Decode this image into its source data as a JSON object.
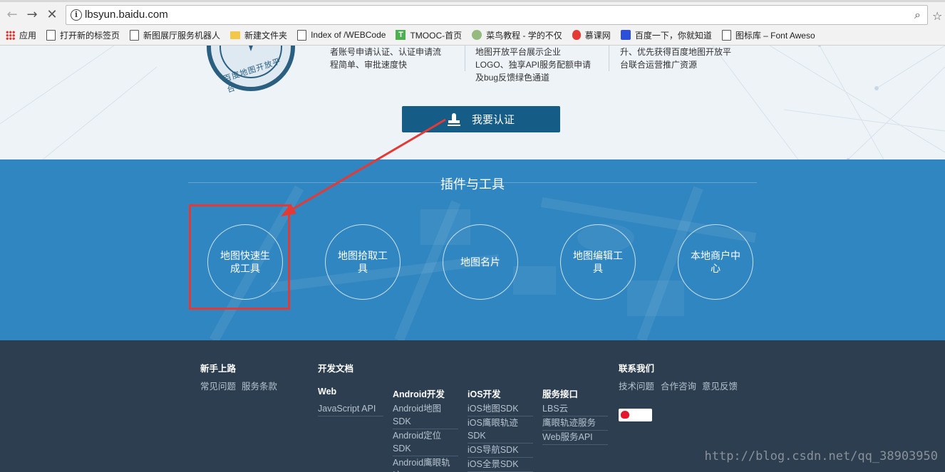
{
  "browser": {
    "url": "lbsyun.baidu.com",
    "bookmarks": [
      {
        "label": "应用",
        "icon": "apps-icon"
      },
      {
        "label": "打开新的标签页",
        "icon": "page-icon"
      },
      {
        "label": "新图展厅服务机器人",
        "icon": "page-icon"
      },
      {
        "label": "新建文件夹",
        "icon": "folder-icon"
      },
      {
        "label": "Index of /WEBCode",
        "icon": "page-icon"
      },
      {
        "label": "TMOOC-首页",
        "icon": "tmooc-icon"
      },
      {
        "label": "菜鸟教程 - 学的不仅",
        "icon": "runoob-icon"
      },
      {
        "label": "慕课网",
        "icon": "imooc-fire-icon"
      },
      {
        "label": "百度一下，你就知道",
        "icon": "baidu-paw-icon"
      },
      {
        "label": "图标库 – Font Aweso",
        "icon": "page-icon"
      }
    ]
  },
  "hero": {
    "seal_text": "百度地图开放平台",
    "features": [
      {
        "lines": [
          "者账号申请认证、认证申请流",
          "程简单、审批速度快"
        ]
      },
      {
        "lines": [
          "地图开放平台展示企业",
          "LOGO、独享API服务配额申请",
          "及bug反馈绿色通道"
        ]
      },
      {
        "lines": [
          "升、优先获得百度地图开放平",
          "台联合运营推广资源"
        ]
      }
    ],
    "certify_label": "我要认证"
  },
  "tools": {
    "title": "插件与工具",
    "items": [
      {
        "label": "地图快速生成工具"
      },
      {
        "label": "地图拾取工具"
      },
      {
        "label": "地图名片"
      },
      {
        "label": "地图编辑工具"
      },
      {
        "label": "本地商户中心"
      }
    ]
  },
  "footer": {
    "newbie": {
      "title": "新手上路",
      "links": [
        "常见问题",
        "服务条款"
      ]
    },
    "docs": {
      "title": "开发文档",
      "columns": [
        {
          "title": "Web",
          "links": [
            "JavaScript API"
          ]
        },
        {
          "title": "Android开发",
          "links": [
            "Android地图SDK",
            "Android定位SDK",
            "Android鹰眼轨迹SDK"
          ]
        },
        {
          "title": "iOS开发",
          "links": [
            "iOS地图SDK",
            "iOS鹰眼轨迹SDK",
            "iOS导航SDK",
            "iOS全景SDK"
          ]
        },
        {
          "title": "服务接口",
          "links": [
            "LBS云",
            "鹰眼轨迹服务",
            "Web服务API"
          ]
        }
      ]
    },
    "contact": {
      "title": "联系我们",
      "links": [
        "技术问题",
        "合作咨询",
        "意见反馈"
      ]
    }
  },
  "watermark": "http://blog.csdn.net/qq_38903950",
  "colors": {
    "tools_bg": "#2f86c0",
    "footer_bg": "#2c3e50",
    "button_bg": "#155c87",
    "annotation_red": "#e53935"
  }
}
